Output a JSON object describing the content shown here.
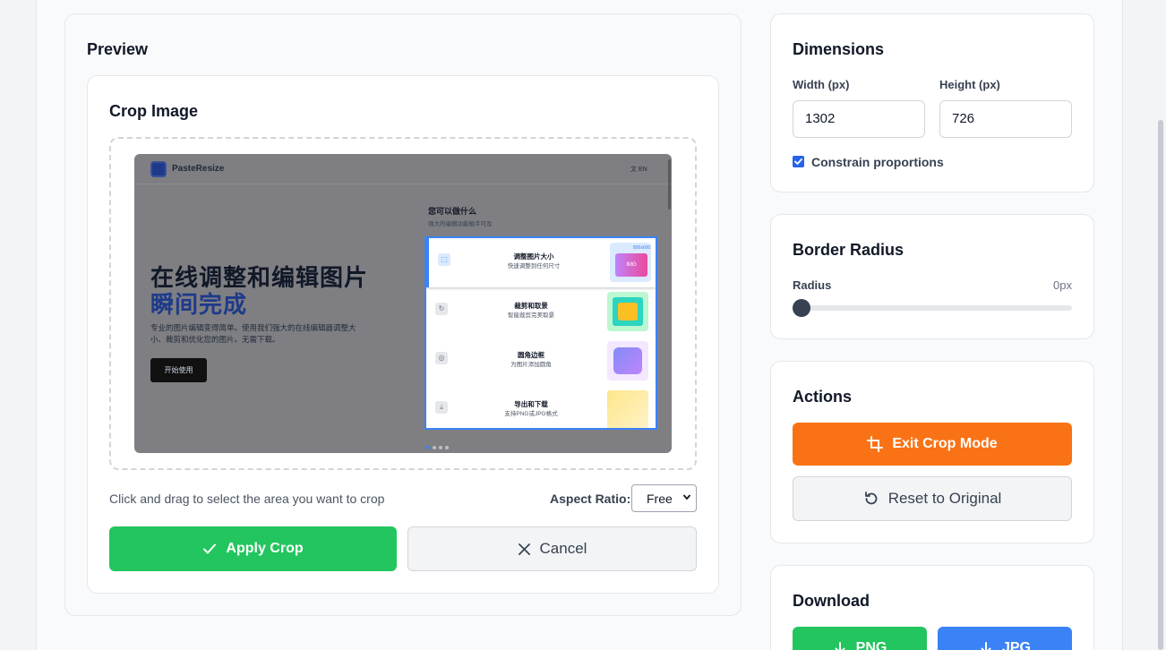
{
  "preview": {
    "title": "Preview",
    "crop_title": "Crop Image",
    "screenshot": {
      "brand": "PasteResize",
      "lang": "文 EN",
      "hero_line1": "在线调整和编辑图片",
      "hero_line2": "瞬间完成",
      "description": "专业的图片编辑变得简单。使用我们强大的在线编辑器调整大小、裁剪和优化您的图片。无需下载。",
      "cta": "开始使用",
      "section_title": "您可以做什么",
      "section_sub": "强大的编辑功能触手可及",
      "features": [
        {
          "name": "调整图片大小",
          "sub": "快速调整到任何尺寸",
          "thumb_label": "IMG",
          "thumb_badge": "800x600"
        },
        {
          "name": "裁剪和取景",
          "sub": "智能裁剪完美取景"
        },
        {
          "name": "圆角边框",
          "sub": "为图片添加圆角"
        },
        {
          "name": "导出和下载",
          "sub": "支持PNG或JPG格式"
        }
      ]
    },
    "hint": "Click and drag to select the area you want to crop",
    "aspect_label": "Aspect Ratio:",
    "aspect_value": "Free",
    "apply_label": "Apply Crop",
    "cancel_label": "Cancel"
  },
  "dimensions": {
    "title": "Dimensions",
    "width_label": "Width (px)",
    "height_label": "Height (px)",
    "width_value": "1302",
    "height_value": "726",
    "constrain_label": "Constrain proportions",
    "constrain_checked": true
  },
  "border_radius": {
    "title": "Border Radius",
    "radius_label": "Radius",
    "radius_value": "0px",
    "radius_level": 0
  },
  "actions": {
    "title": "Actions",
    "exit_crop_label": "Exit Crop Mode",
    "reset_label": "Reset to Original"
  },
  "download": {
    "title": "Download",
    "png_label": "PNG",
    "jpg_label": "JPG"
  },
  "colors": {
    "accent_green": "#22c55e",
    "accent_orange": "#f97316",
    "accent_blue": "#3b82f6",
    "checkbox_blue": "#2563eb"
  }
}
